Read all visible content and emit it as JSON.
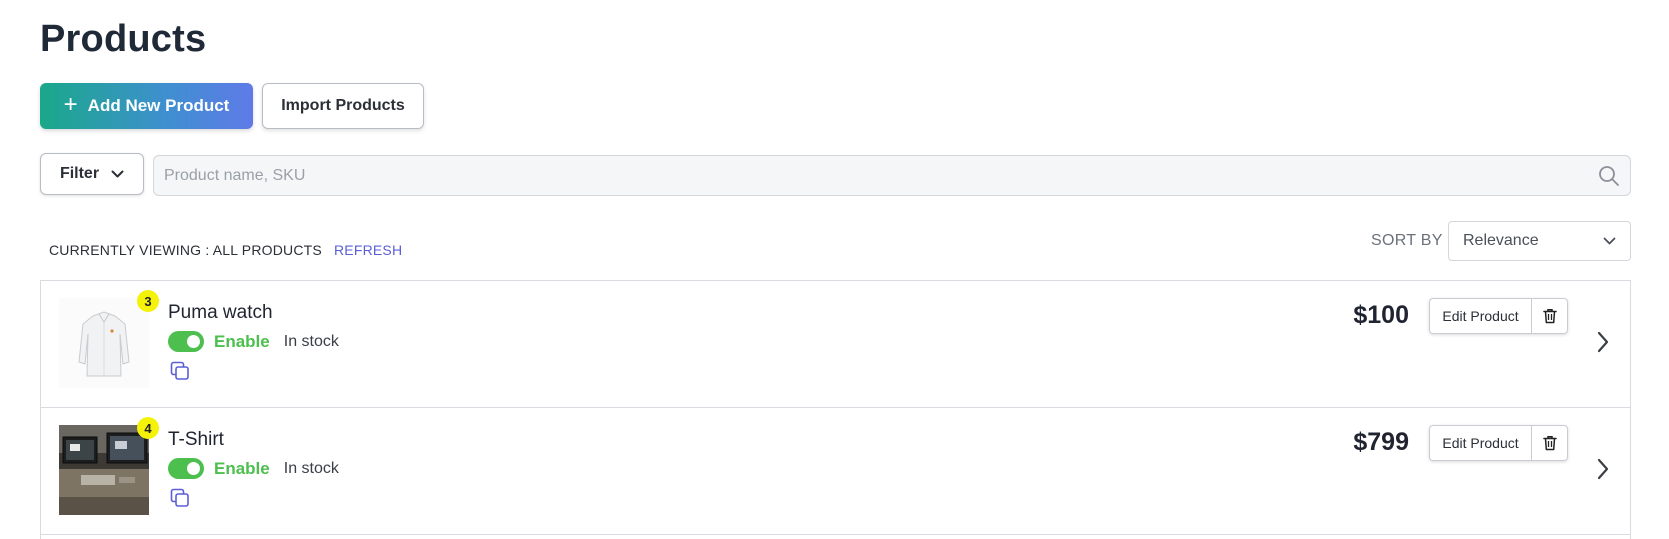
{
  "page": {
    "title": "Products"
  },
  "toolbar": {
    "add_label": "Add New Product",
    "import_label": "Import Products",
    "filter_label": "Filter"
  },
  "search": {
    "placeholder": "Product name, SKU",
    "value": ""
  },
  "view": {
    "currently_viewing": "CURRENTLY VIEWING : ALL PRODUCTS",
    "refresh_label": "REFRESH",
    "sort_label": "SORT BY",
    "sort_value": "Relevance"
  },
  "products": [
    {
      "badge": "3",
      "name": "Puma watch",
      "status": "Enable",
      "stock": "In stock",
      "price": "$100",
      "edit_label": "Edit Product",
      "thumb": "white-shirt"
    },
    {
      "badge": "4",
      "name": "T-Shirt",
      "status": "Enable",
      "stock": "In stock",
      "price": "$799",
      "edit_label": "Edit Product",
      "thumb": "desk-monitors"
    }
  ],
  "colors": {
    "accent": "#5b5fd6",
    "enabled": "#4cbf4e",
    "badge": "#f5f20a",
    "gradient_start": "#1aa88a",
    "gradient_end": "#5f7ae8"
  }
}
